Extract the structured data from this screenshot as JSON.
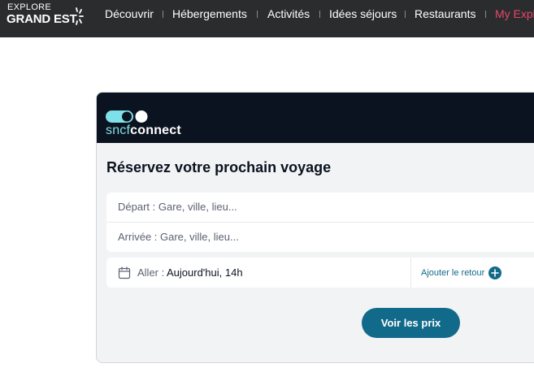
{
  "site": {
    "logo_line1": "EXPLORE",
    "logo_line2": "GRAND EST"
  },
  "nav": {
    "items": [
      {
        "label": "Découvrir"
      },
      {
        "label": "Hébergements"
      },
      {
        "label": "Activités"
      },
      {
        "label": "Idées séjours"
      },
      {
        "label": "Restaurants"
      },
      {
        "label": "My Explo"
      }
    ]
  },
  "widget": {
    "brand_a": "sncf",
    "brand_b": "connect",
    "title": "Réservez votre prochain voyage",
    "departure_placeholder": "Départ : Gare, ville, lieu...",
    "arrival_placeholder": "Arrivée : Gare, ville, lieu...",
    "outbound_label": "Aller :",
    "outbound_value": "Aujourd'hui, 14h",
    "add_return_label": "Ajouter le retour",
    "cta_label": "Voir les prix"
  },
  "colors": {
    "topbar": "#2b2c2e",
    "accent_nav": "#e5476b",
    "card_header": "#0c1320",
    "primary": "#126a8a",
    "brand_teal": "#7ee0e8"
  }
}
